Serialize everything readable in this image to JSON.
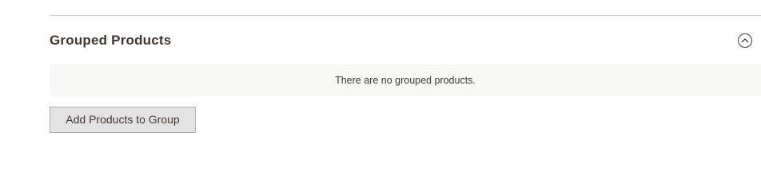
{
  "section": {
    "title": "Grouped Products",
    "toggle_icon": "chevron-up-circle-icon"
  },
  "empty_state": {
    "message": "There are no grouped products."
  },
  "actions": {
    "add_label": "Add Products to Group"
  },
  "colors": {
    "text": "#41362f",
    "empty_bg": "#f8f8f6",
    "button_bg": "#e3e3e3",
    "button_border": "#adadad",
    "divider": "#cccccc"
  }
}
